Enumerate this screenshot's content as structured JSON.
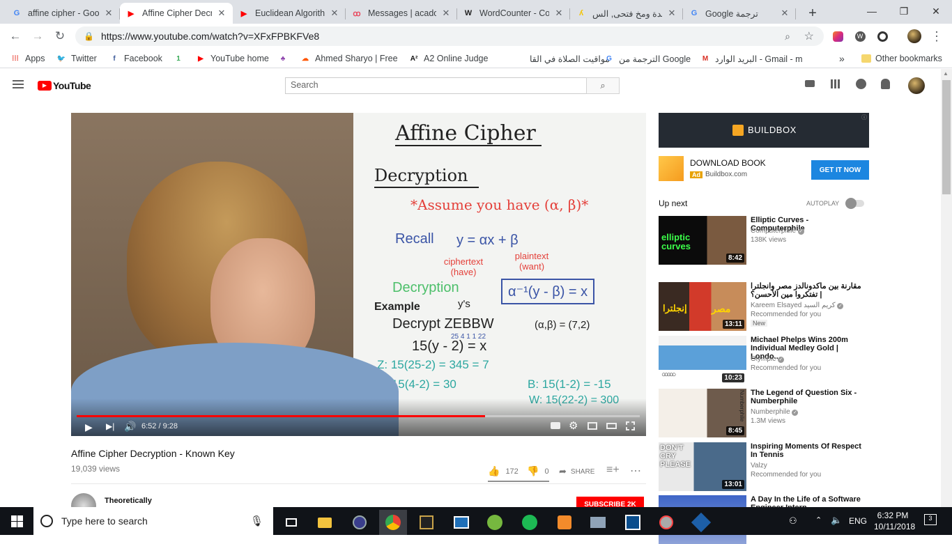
{
  "browser": {
    "tabs": [
      {
        "title": "affine cipher - Goo",
        "icon": "google-icon",
        "color": "#4285f4",
        "glyph": "G"
      },
      {
        "title": "Affine Cipher Decr",
        "icon": "youtube-icon",
        "color": "#ff0000",
        "glyph": "▶",
        "active": true
      },
      {
        "title": "Euclidean Algorith",
        "icon": "youtube-icon",
        "color": "#ff0000",
        "glyph": "▶"
      },
      {
        "title": "Messages | acadox",
        "icon": "acadox-icon",
        "color": "#e84a5f",
        "glyph": "ꝏ"
      },
      {
        "title": "WordCounter - Co",
        "icon": "wordcounter-icon",
        "color": "#222222",
        "glyph": "W"
      },
      {
        "title": "كبدة ومخ فتحى, الس",
        "icon": "yelp-icon",
        "color": "#f5c400",
        "glyph": "ʎ"
      },
      {
        "title": "Google ترجمة",
        "icon": "google-translate-icon",
        "color": "#4285f4",
        "glyph": "G"
      }
    ],
    "new_tab": "+",
    "url": "https://www.youtube.com/watch?v=XFxFPBKFVe8",
    "bookmarks": [
      {
        "label": "Apps",
        "icon": "apps-grid-icon",
        "color": "#e94235",
        "glyph": "⁞⁞⁞"
      },
      {
        "label": "Twitter",
        "icon": "twitter-icon",
        "color": "#1da1f2",
        "glyph": "🐦"
      },
      {
        "label": "Facebook",
        "icon": "facebook-icon",
        "color": "#3b5998",
        "glyph": "f"
      },
      {
        "label": "",
        "icon": "green-one-icon",
        "color": "#34a853",
        "glyph": "1"
      },
      {
        "label": "YouTube home",
        "icon": "youtube-icon",
        "color": "#ff0000",
        "glyph": "▶"
      },
      {
        "label": "",
        "icon": "purple-bird-icon",
        "color": "#8e44ad",
        "glyph": "♣"
      },
      {
        "label": "Ahmed Sharyo | Free",
        "icon": "soundcloud-icon",
        "color": "#ff5500",
        "glyph": "☁"
      },
      {
        "label": "A2 Online Judge",
        "icon": "a2-icon",
        "color": "#111111",
        "glyph": "A²"
      },
      {
        "label": "مواقيت الصلاة في القا",
        "icon": "blank-page-icon",
        "color": "#9aa0a6",
        "glyph": ""
      },
      {
        "label": "الترجمة من Google",
        "icon": "google-translate-icon",
        "color": "#4285f4",
        "glyph": "G"
      },
      {
        "label": "البريد الوارد - Gmail - m",
        "icon": "gmail-icon",
        "color": "#d93025",
        "glyph": "M"
      }
    ],
    "more_bookmarks": "»",
    "other_bookmarks": "Other bookmarks"
  },
  "youtube": {
    "logo": "YouTube",
    "search_placeholder": "Search",
    "video": {
      "title": "Affine Cipher Decryption - Known Key",
      "views": "19,039 views",
      "time": "6:52 / 9:28",
      "progress": 0.725,
      "likes": "172",
      "dislikes": "0",
      "share": "SHARE",
      "channel": "Theoretically",
      "subscribe": "SUBSCRIBE 2K",
      "board": {
        "heading": "Affine Cipher",
        "sub": "Decryption",
        "assume": "*Assume you have (α, β)*",
        "recall": "Recall",
        "formula": "y = αx + β",
        "cipher_label": "ciphertext (have)",
        "plain_label": "plaintext (want)",
        "decryption": "Decryption",
        "boxed": "α⁻¹(y - β) = x",
        "ys": "y's",
        "example": "Example",
        "decrypt_line": "Decrypt ZEBBW",
        "key": "(α,β) = (7,2)",
        "digits": "25 4 1 1 22",
        "gen": "15(y - 2) = x",
        "z_line": "Z: 15(25-2) = 345 = 7",
        "e_line": "E: 15(4-2) = 30",
        "b_line": "B: 15(1-2) = -15",
        "w_line": "W: 15(22-2) = 300"
      }
    },
    "ad": {
      "brand": "BUILDBOX",
      "headline": "DOWNLOAD BOOK",
      "badge": "Ad",
      "domain": "Buildbox.com",
      "cta": "GET IT NOW"
    },
    "up_next": "Up next",
    "autoplay": "AUTOPLAY",
    "recommendations": [
      {
        "title": "Elliptic Curves - Computerphile",
        "channel": "Computerphile",
        "meta": "138K views",
        "duration": "8:42",
        "verified": true,
        "badge": ""
      },
      {
        "title": "مقارنة بين ماكدونالدز مصر وانجلترا | تفتكروا مين الأحسن؟",
        "channel": "Kareem Elsayed كريم السيد",
        "meta": "Recommended for you",
        "duration": "13:11",
        "verified": true,
        "badge": "New"
      },
      {
        "title": "Michael Phelps Wins 200m Individual Medley Gold | Londo...",
        "channel": "Olympic",
        "meta": "Recommended for you",
        "duration": "10:23",
        "verified": true,
        "badge": ""
      },
      {
        "title": "The Legend of Question Six - Numberphile",
        "channel": "Numberphile",
        "meta": "1.3M views",
        "duration": "8:45",
        "verified": true,
        "badge": ""
      },
      {
        "title": "Inspiring Moments Of Respect In Tennis",
        "channel": "Valzy",
        "meta": "Recommended for you",
        "duration": "13:01",
        "verified": false,
        "badge": ""
      },
      {
        "title": "A Day In the Life of a Software Engineer Intern",
        "channel": "",
        "meta": "",
        "duration": "",
        "verified": false,
        "badge": ""
      }
    ],
    "thumb_texts": {
      "elliptic": "elliptic curves",
      "masr": "مصر",
      "england": "إنجلترا",
      "dont_cry": "DON'T CRY PLEASE",
      "numberphile": "Numberphile"
    }
  },
  "taskbar": {
    "search_placeholder": "Type here to search",
    "lang": "ENG",
    "time": "6:32 PM",
    "date": "10/11/2018",
    "notifications": "3"
  }
}
